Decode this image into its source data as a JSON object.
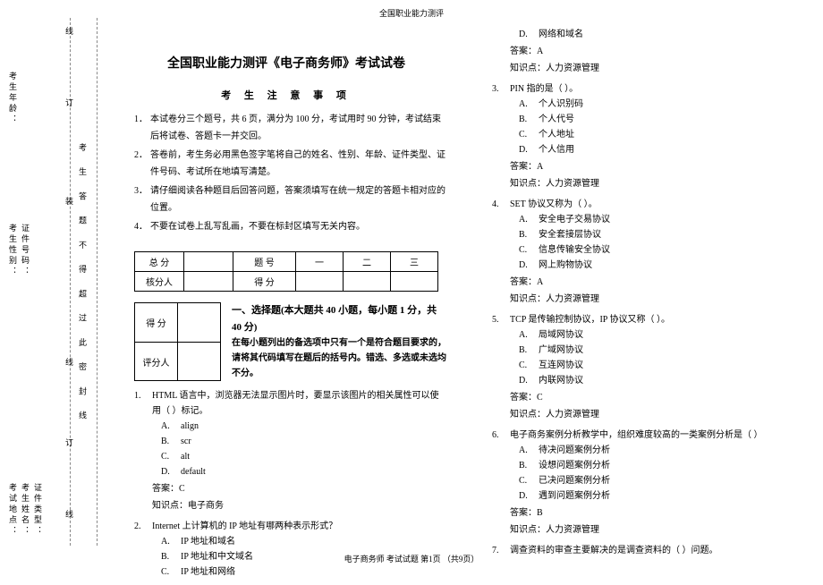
{
  "page_header": "全国职业能力测评",
  "page_footer": "电子商务师  考试试题  第1页 （共9页）",
  "binding": {
    "labels": [
      "考试地点：",
      "考生姓名：",
      "证件类型：",
      "考生性别：",
      "证件号码：",
      "考生年龄："
    ],
    "vertical_note": "考 生 答 题 不 得 超 过 此 密 封 线",
    "cut_marks": [
      "线",
      "订",
      "装",
      "线",
      "订",
      "线"
    ]
  },
  "title": "全国职业能力测评《电子商务师》考试试卷",
  "notice_title": "考 生 注 意 事 项",
  "notices": [
    "本试卷分三个题号，共 6 页，满分为 100 分，考试用时 90 分钟，考试结束后将试卷、答题卡一并交回。",
    "答卷前，考生务必用黑色签字笔将自己的姓名、性别、年龄、证件类型、证件号码、考试所在地填写清楚。",
    "请仔细阅读各种题目后回答问题，答案须填写在统一规定的答题卡相对应的位置。",
    "不要在试卷上乱写乱画，不要在标封区填写无关内容。"
  ],
  "score_table": {
    "row1": [
      "总 分",
      "",
      "题  号",
      "一",
      "二",
      "三"
    ],
    "row2": [
      "核分人",
      "",
      "得  分",
      "",
      "",
      ""
    ]
  },
  "mini_table": {
    "r1": [
      "得  分",
      ""
    ],
    "r2": [
      "评分人",
      ""
    ]
  },
  "section1": {
    "heading": "一、选择题(本大题共 40 小题，每小题 1 分，共 40 分)",
    "note": "在每小题列出的备选项中只有一个是符合题目要求的，请将其代码填写在题后的括号内。错选、多选或未选均不分。"
  },
  "ans_label": "答案：",
  "kp_label": "知识点：",
  "kp_ec": "电子商务",
  "kp_hr": "人力资源管理",
  "questions": [
    {
      "num": "1.",
      "text": "HTML 语言中，浏览器无法显示图片时，要显示该图片的相关属性可以使用（    ）标记。",
      "opts": [
        [
          "A.",
          "align"
        ],
        [
          "B.",
          "scr"
        ],
        [
          "C.",
          "alt"
        ],
        [
          "D.",
          "default"
        ]
      ],
      "ans": "C",
      "kp": "电子商务"
    },
    {
      "num": "2.",
      "text": "Internet 上计算机的 IP 地址有哪两种表示形式？",
      "opts": [
        [
          "A.",
          "IP 地址和域名"
        ],
        [
          "B.",
          "IP 地址和中文域名"
        ],
        [
          "C.",
          "IP 地址和网络"
        ]
      ]
    },
    {
      "num_cont": true,
      "opts": [
        [
          "D.",
          "网络和域名"
        ]
      ],
      "ans": "A",
      "kp": "人力资源管理"
    },
    {
      "num": "3.",
      "text": "PIN 指的是（                    ）。",
      "opts": [
        [
          "A.",
          "个人识别码"
        ],
        [
          "B.",
          "个人代号"
        ],
        [
          "C.",
          "个人地址"
        ],
        [
          "D.",
          "个人信用"
        ]
      ],
      "ans": "A",
      "kp": "人力资源管理"
    },
    {
      "num": "4.",
      "text": "SET 协议又称为（                      ）。",
      "opts": [
        [
          "A.",
          "安全电子交易协议"
        ],
        [
          "B.",
          "安全套接层协议"
        ],
        [
          "C.",
          "信息传输安全协议"
        ],
        [
          "D.",
          "网上购物协议"
        ]
      ],
      "ans": "A",
      "kp": "人力资源管理"
    },
    {
      "num": "5.",
      "text": "TCP 是传输控制协议，IP 协议又称（    ）。",
      "opts": [
        [
          "A.",
          "局域网协议"
        ],
        [
          "B.",
          "广域网协议"
        ],
        [
          "C.",
          "互连网协议"
        ],
        [
          "D.",
          "内联网协议"
        ]
      ],
      "ans": "C",
      "kp": "人力资源管理"
    },
    {
      "num": "6.",
      "text": "电子商务案例分析教学中，组织难度较高的一类案例分析是（            ）",
      "opts": [
        [
          "A.",
          "待决问题案例分析"
        ],
        [
          "B.",
          "设想问题案例分析"
        ],
        [
          "C.",
          "已决问题案例分析"
        ],
        [
          "D.",
          "遇到问题案例分析"
        ]
      ],
      "ans": "B",
      "kp": "人力资源管理"
    },
    {
      "num": "7.",
      "text": "调查资料的审查主要解决的是调查资料的（                    ）问题。"
    }
  ]
}
